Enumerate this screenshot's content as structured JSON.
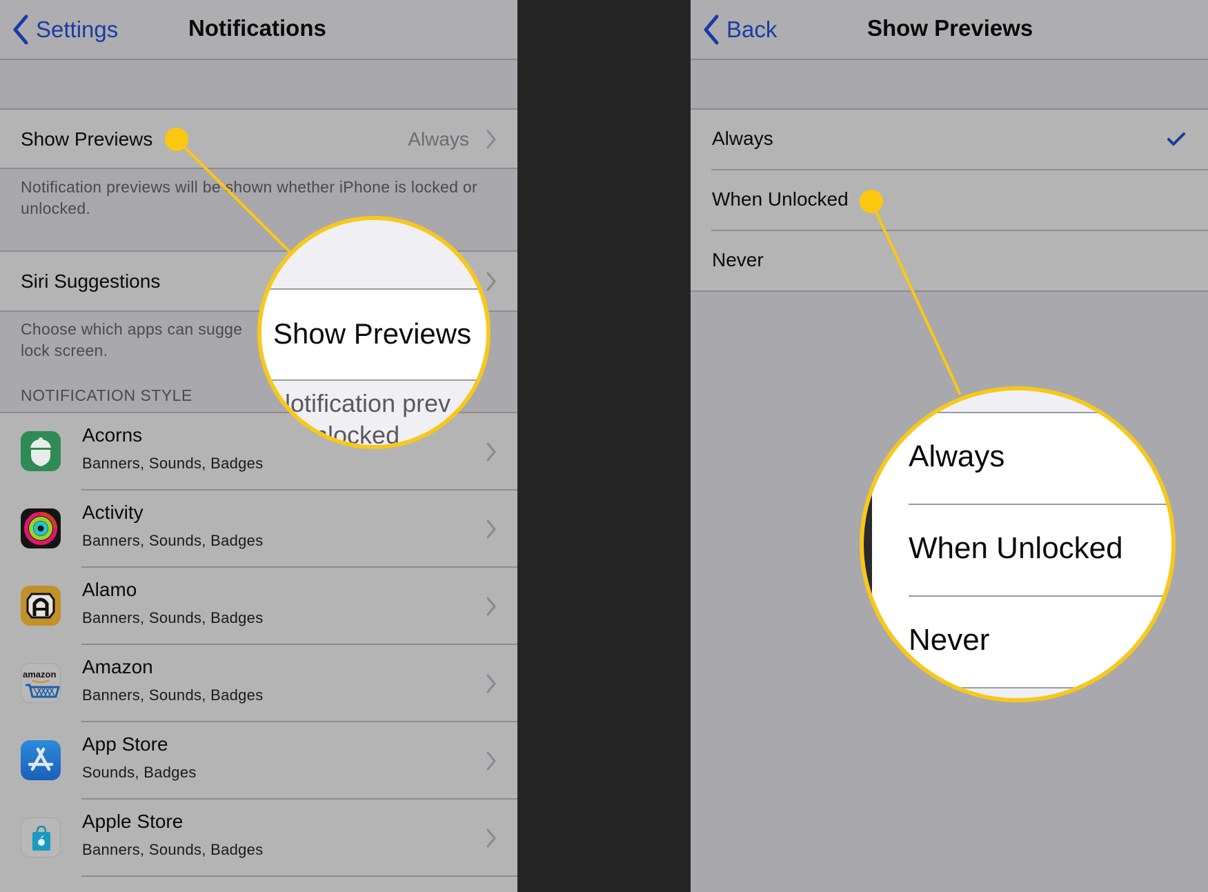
{
  "left_screen": {
    "nav": {
      "back_label": "Settings",
      "back_icon": "chevron-left-icon",
      "title": "Notifications"
    },
    "show_previews": {
      "label": "Show Previews",
      "value": "Always",
      "footer": "Notification previews will be shown whether iPhone is locked or unlocked."
    },
    "siri_suggestions": {
      "label": "Siri Suggestions",
      "footer_visible": "Choose which apps can sugge",
      "footer_line2": "lock screen."
    },
    "section_header": "NOTIFICATION STYLE",
    "apps": [
      {
        "name": "Acorns",
        "subtitle": "Banners, Sounds, Badges",
        "icon": "acorns-icon"
      },
      {
        "name": "Activity",
        "subtitle": "Banners, Sounds, Badges",
        "icon": "activity-icon"
      },
      {
        "name": "Alamo",
        "subtitle": "Banners, Sounds, Badges",
        "icon": "alamo-icon"
      },
      {
        "name": "Amazon",
        "subtitle": "Banners, Sounds, Badges",
        "icon": "amazon-icon"
      },
      {
        "name": "App Store",
        "subtitle": "Sounds, Badges",
        "icon": "app-store-icon"
      },
      {
        "name": "Apple Store",
        "subtitle": "Banners, Sounds, Badges",
        "icon": "apple-store-icon"
      }
    ],
    "amazon_icon_text": "amazon",
    "magnifier": {
      "label": "Show Previews",
      "footer_fragment_1": "lotification prev",
      "footer_fragment_2": "nlocked"
    }
  },
  "right_screen": {
    "nav": {
      "back_label": "Back",
      "back_icon": "chevron-left-icon",
      "title": "Show Previews"
    },
    "options": [
      {
        "label": "Always",
        "selected": true
      },
      {
        "label": "When Unlocked",
        "selected": false
      },
      {
        "label": "Never",
        "selected": false
      }
    ],
    "magnifier": {
      "options": [
        "Always",
        "When Unlocked",
        "Never"
      ]
    }
  },
  "colors": {
    "accent_blue": "#1a3ba6",
    "highlight_yellow": "#fcc80f",
    "divider_dark": "#252525"
  }
}
